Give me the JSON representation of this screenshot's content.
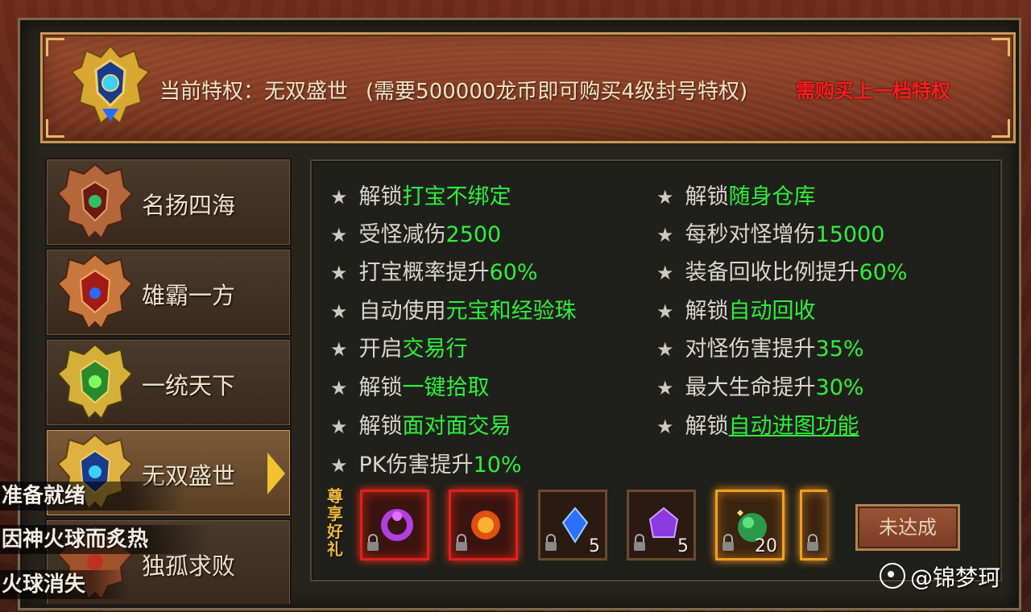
{
  "header": {
    "current_label": "当前特权：无双盛世",
    "requirement": "(需要500000龙币即可购买4级封号特权)",
    "warning": "需购买上一档特权"
  },
  "tiers": [
    {
      "label": "名扬四海",
      "selected": false
    },
    {
      "label": "雄霸一方",
      "selected": false
    },
    {
      "label": "一统天下",
      "selected": false
    },
    {
      "label": "无双盛世",
      "selected": true
    },
    {
      "label": "独孤求败",
      "selected": false
    }
  ],
  "perks_left": [
    {
      "prefix": "解锁",
      "highlight": "打宝不绑定",
      "suffix": ""
    },
    {
      "prefix": "受怪减伤",
      "highlight": "2500",
      "suffix": ""
    },
    {
      "prefix": "打宝概率提升",
      "highlight": "60%",
      "suffix": ""
    },
    {
      "prefix": "自动使用",
      "highlight": "元宝和经验珠",
      "suffix": ""
    },
    {
      "prefix": "开启",
      "highlight": "交易行",
      "suffix": ""
    },
    {
      "prefix": "解锁",
      "highlight": "一键拾取",
      "suffix": ""
    },
    {
      "prefix": "解锁",
      "highlight": "面对面交易",
      "suffix": ""
    },
    {
      "prefix": "PK伤害提升",
      "highlight": "10%",
      "suffix": ""
    }
  ],
  "perks_right": [
    {
      "prefix": "解锁",
      "highlight": "随身仓库",
      "suffix": ""
    },
    {
      "prefix": "每秒对怪增伤",
      "highlight": "15000",
      "suffix": ""
    },
    {
      "prefix": "装备回收比例提升",
      "highlight": "60%",
      "suffix": ""
    },
    {
      "prefix": "解锁",
      "highlight": "自动回收",
      "suffix": ""
    },
    {
      "prefix": "对怪伤害提升",
      "highlight": "35%",
      "suffix": ""
    },
    {
      "prefix": "最大生命提升",
      "highlight": "30%",
      "suffix": ""
    },
    {
      "prefix": "解锁",
      "highlight": "自动进图功能",
      "suffix": ""
    }
  ],
  "gift": {
    "label": "尊享好礼",
    "items": [
      {
        "icon": "purple-ring-icon",
        "count": "",
        "frame": "red"
      },
      {
        "icon": "fire-orb-icon",
        "count": "",
        "frame": "red"
      },
      {
        "icon": "blue-gem-icon",
        "count": "5",
        "frame": "plain"
      },
      {
        "icon": "purple-crystal-icon",
        "count": "5",
        "frame": "plain"
      },
      {
        "icon": "green-herb-icon",
        "count": "20",
        "frame": "gold"
      },
      {
        "icon": "partial-item-icon",
        "count": "",
        "frame": "gold"
      }
    ]
  },
  "status_button": "未达成",
  "chat_overlay": [
    "准备就绪",
    "因神火球而炙热",
    "火球消失"
  ],
  "watermark": "@锦梦珂",
  "colors": {
    "highlight": "#2ef03a",
    "warning": "#ff1c1c",
    "text": "#d9d5ce"
  }
}
